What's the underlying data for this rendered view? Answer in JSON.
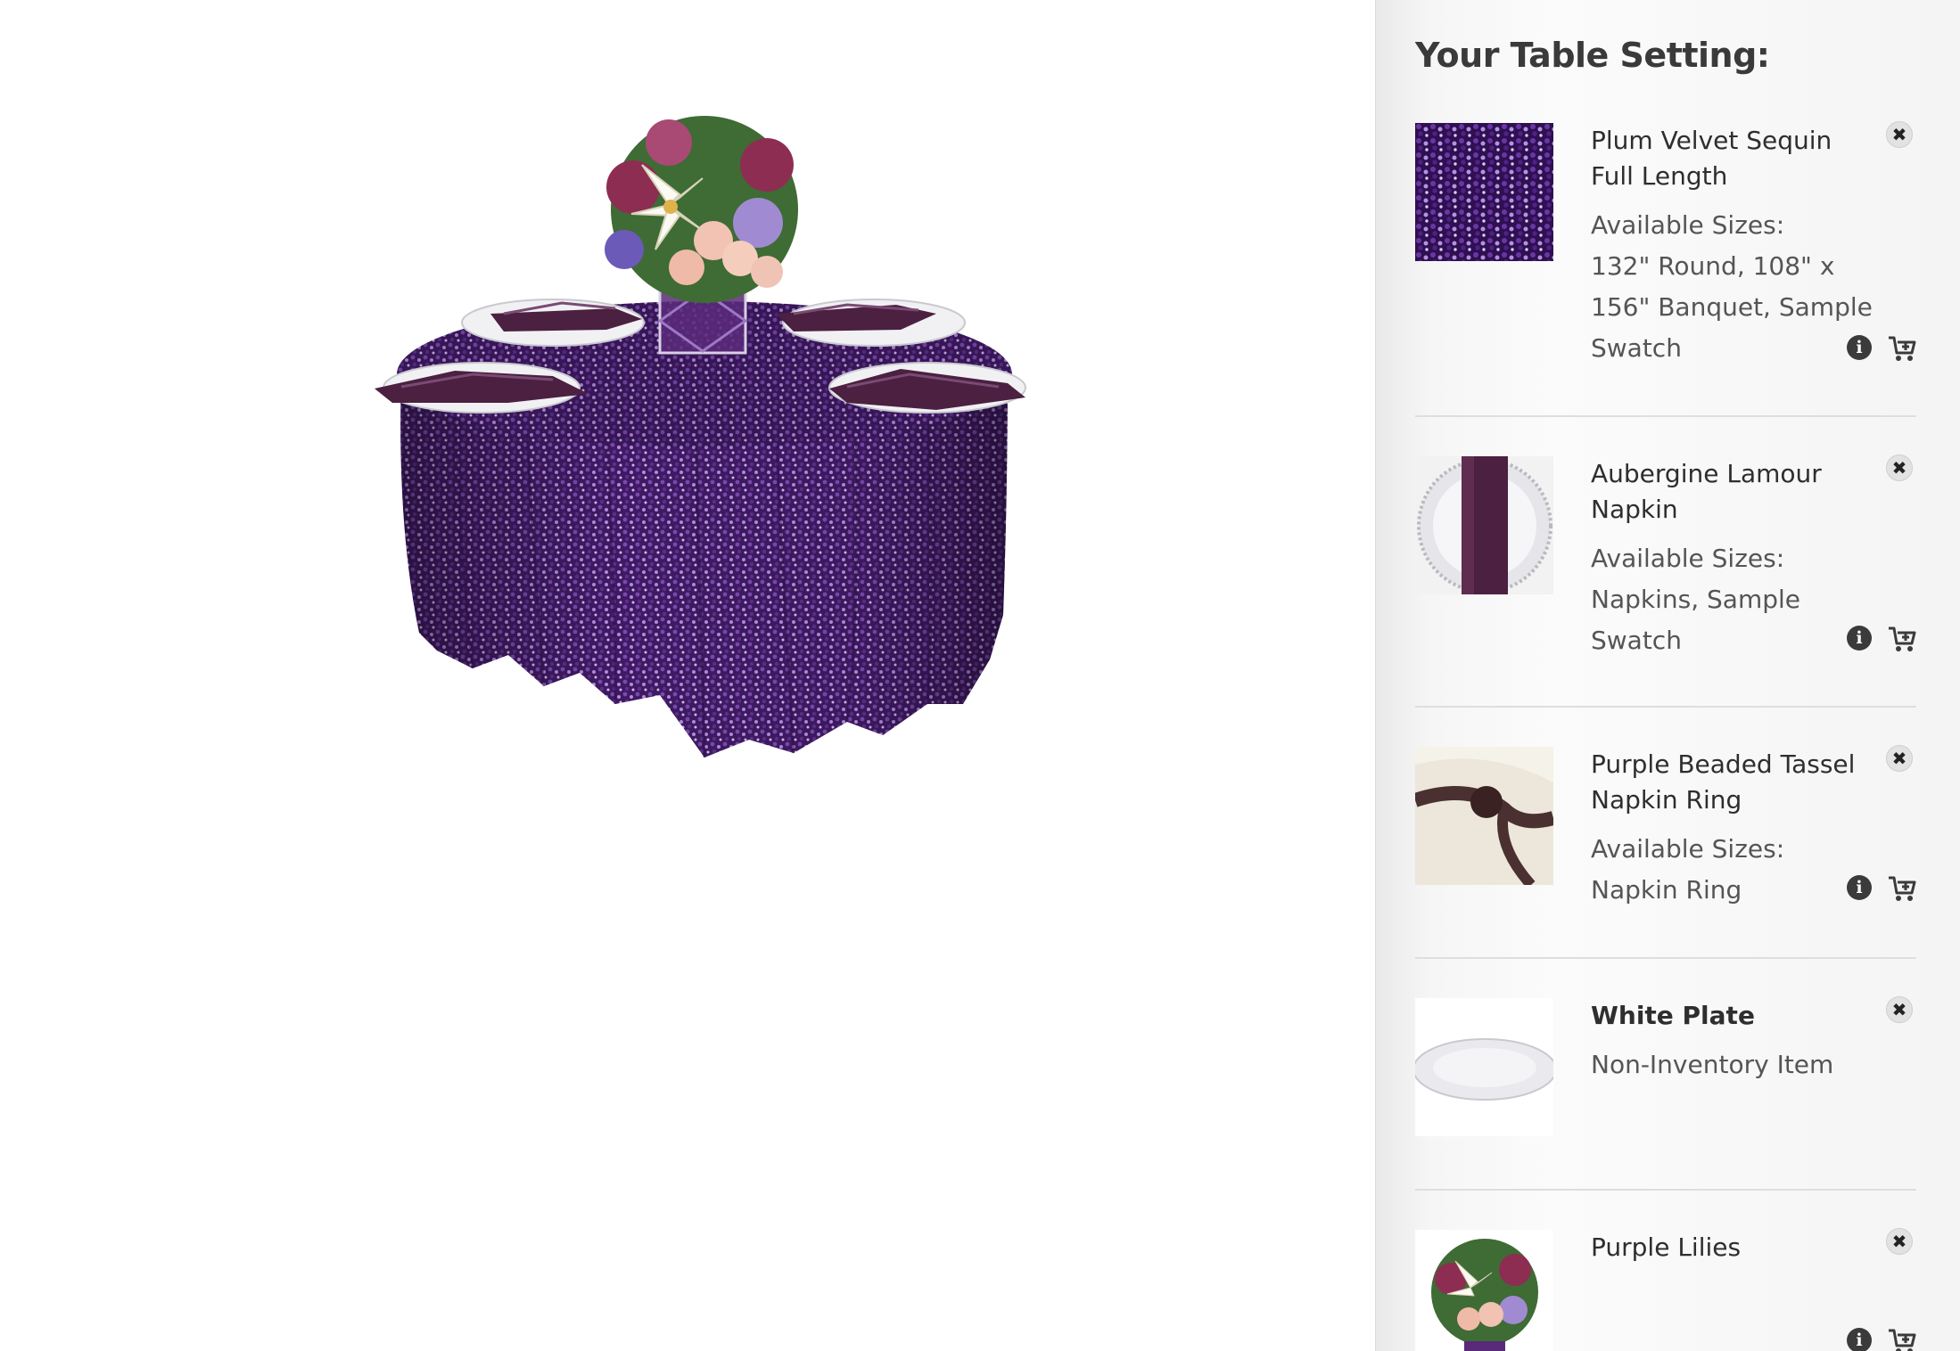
{
  "panel": {
    "title": "Your Table Setting:",
    "items": [
      {
        "name": "Plum Velvet Sequin Full Length",
        "sizes_label": "Available Sizes:",
        "sizes": "132\" Round, 108\" x 156\" Banquet, Sample Swatch",
        "thumbnail": "plum-sequin-fabric",
        "remove_glyph": "✖",
        "info_glyph": "i"
      },
      {
        "name": "Aubergine Lamour Napkin",
        "sizes_label": "Available Sizes:",
        "sizes": "Napkins, Sample Swatch",
        "thumbnail": "aubergine-napkin-on-charger",
        "remove_glyph": "✖",
        "info_glyph": "i"
      },
      {
        "name": "Purple Beaded Tassel Napkin Ring",
        "sizes_label": "Available Sizes:",
        "sizes": "Napkin Ring",
        "thumbnail": "beaded-tassel-napkin-ring",
        "remove_glyph": "✖",
        "info_glyph": "i"
      },
      {
        "name": "White Plate",
        "note": "Non-Inventory Item",
        "thumbnail": "white-plate",
        "remove_glyph": "✖"
      },
      {
        "name": "Purple Lilies",
        "thumbnail": "lily-bouquet",
        "remove_glyph": "✖",
        "info_glyph": "i"
      }
    ]
  },
  "colors": {
    "sequin_purple": "#4a1f6e",
    "sequin_highlight": "#a679d6",
    "napkin_aubergine": "#4b2040",
    "panel_bg": "#f6f6f6",
    "text_dark": "#2e2e2e",
    "icon_dark": "#3b3b3b"
  }
}
